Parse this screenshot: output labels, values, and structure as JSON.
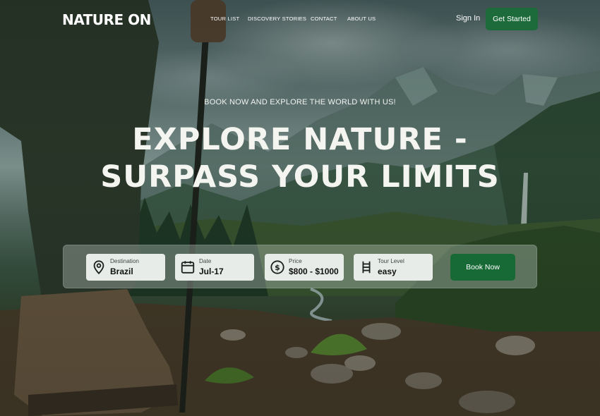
{
  "brand": {
    "logo": "NATURE ON"
  },
  "nav": {
    "items": [
      {
        "label": "TOUR LIST"
      },
      {
        "label": "DISCOVERY STORIES"
      },
      {
        "label": "CONTACT"
      },
      {
        "label": "ABOUT US"
      }
    ],
    "sign_in": "Sign In",
    "get_started": "Get Started"
  },
  "hero": {
    "kicker": "BOOK NOW AND EXPLORE THE WORLD WITH US!",
    "headline_line1": "EXPLORE NATURE -",
    "headline_line2": "SURPASS YOUR LIMITS"
  },
  "booking": {
    "fields": [
      {
        "label": "Destination",
        "value": "Brazil",
        "icon": "map-pin-icon"
      },
      {
        "label": "Date",
        "value": "Jul-17",
        "icon": "calendar-icon"
      },
      {
        "label": "Price",
        "value": "$800 - $1000",
        "icon": "dollar-icon"
      },
      {
        "label": "Tour Level",
        "value": "easy",
        "icon": "ladder-icon"
      }
    ],
    "book_button": "Book Now"
  },
  "colors": {
    "accent": "#1d6b3a",
    "field_bg": "#e7ece8"
  }
}
